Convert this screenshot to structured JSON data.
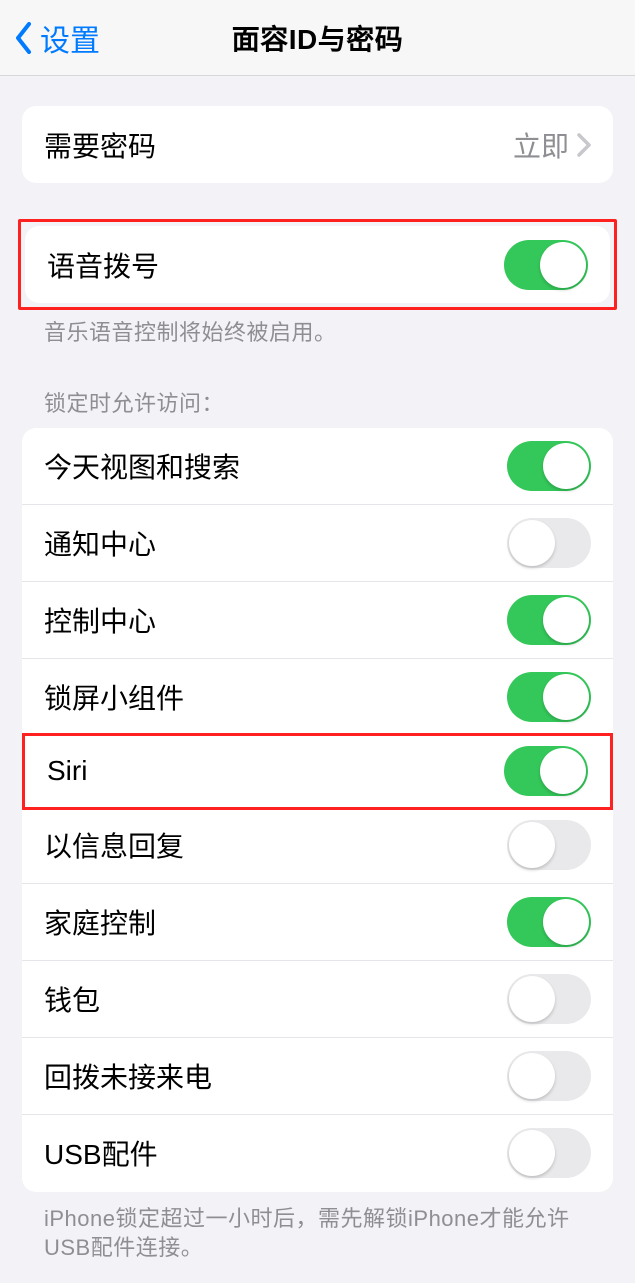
{
  "nav": {
    "back_label": "设置",
    "title": "面容ID与密码"
  },
  "passcode": {
    "label": "需要密码",
    "value": "立即"
  },
  "voice_dial": {
    "label": "语音拨号",
    "on": true,
    "footer": "音乐语音控制将始终被启用。"
  },
  "lock_access": {
    "header": "锁定时允许访问：",
    "items": [
      {
        "label": "今天视图和搜索",
        "on": true
      },
      {
        "label": "通知中心",
        "on": false
      },
      {
        "label": "控制中心",
        "on": true
      },
      {
        "label": "锁屏小组件",
        "on": true
      },
      {
        "label": "Siri",
        "on": true
      },
      {
        "label": "以信息回复",
        "on": false
      },
      {
        "label": "家庭控制",
        "on": true
      },
      {
        "label": "钱包",
        "on": false
      },
      {
        "label": "回拨未接来电",
        "on": false
      },
      {
        "label": "USB配件",
        "on": false
      }
    ],
    "footer": "iPhone锁定超过一小时后，需先解锁iPhone才能允许USB配件连接。"
  }
}
